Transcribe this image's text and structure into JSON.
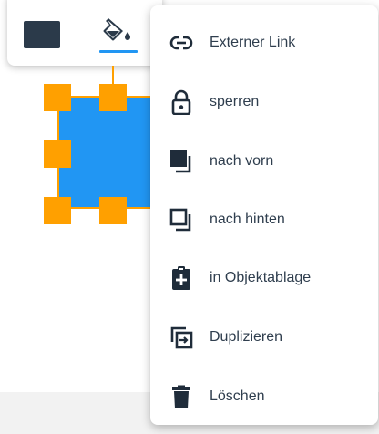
{
  "toolbar": {
    "color_swatch": "#2b3a4a",
    "buttons": [
      "color-swatch",
      "fill-bucket-icon"
    ],
    "active_tab_color": "#2196f3"
  },
  "shape": {
    "fill": "#2196f3",
    "handle_color": "#ffa000"
  },
  "menu": {
    "items": [
      {
        "label": "Externer Link",
        "icon": "link-icon"
      },
      {
        "label": "sperren",
        "icon": "lock-icon"
      },
      {
        "label": "nach vorn",
        "icon": "bring-to-front-icon"
      },
      {
        "label": "nach hinten",
        "icon": "send-to-back-icon"
      },
      {
        "label": "in Objektablage",
        "icon": "clipboard-add-icon"
      },
      {
        "label": "Duplizieren",
        "icon": "duplicate-icon"
      },
      {
        "label": "Löschen",
        "icon": "trash-icon"
      }
    ]
  }
}
